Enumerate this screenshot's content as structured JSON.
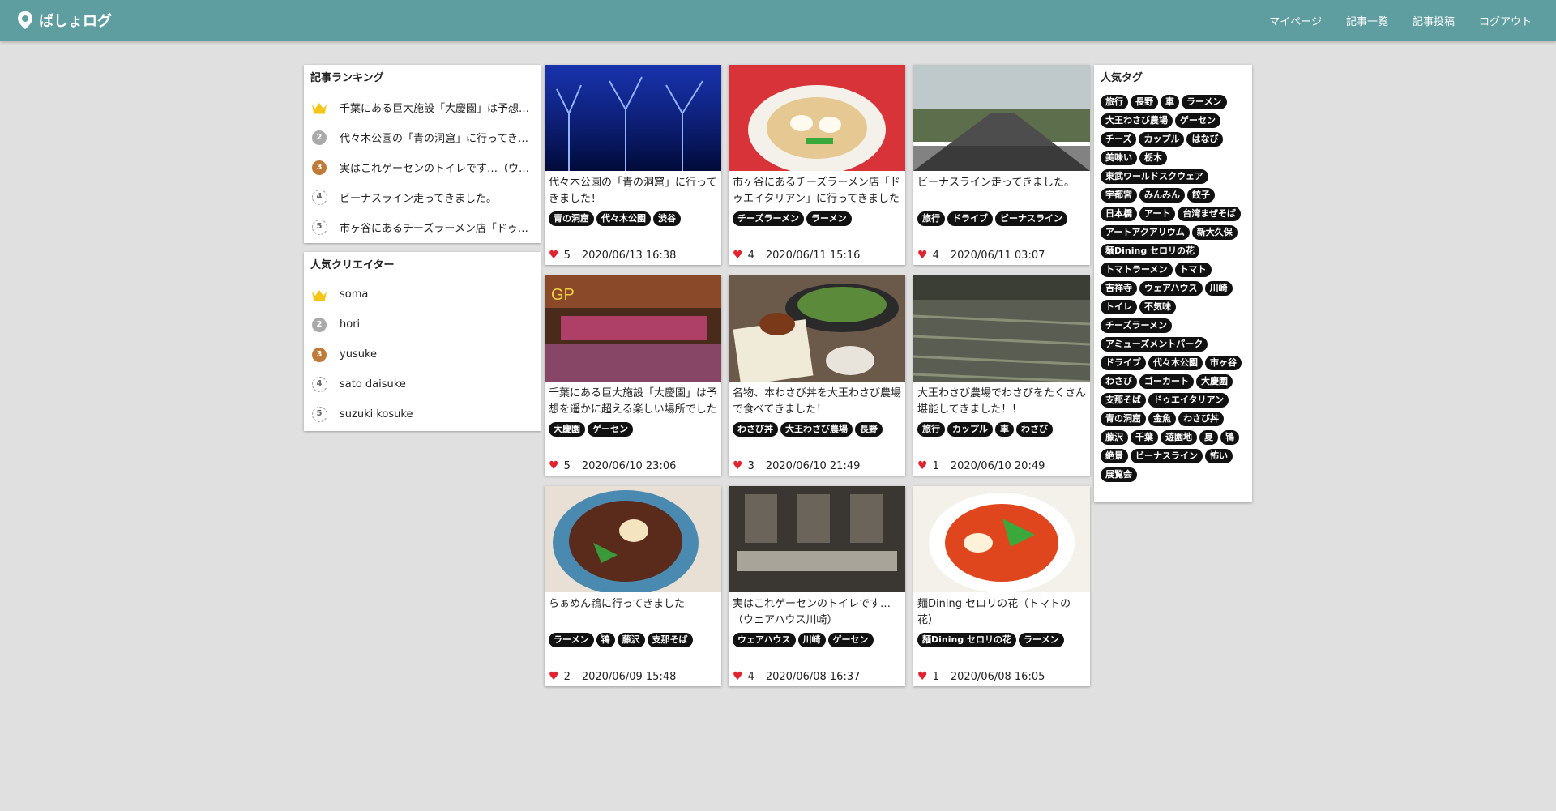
{
  "app": {
    "title": "ばしょログ"
  },
  "nav": {
    "mypage": "マイページ",
    "articles": "記事一覧",
    "post": "記事投稿",
    "logout": "ログアウト"
  },
  "ranking": {
    "title": "記事ランキング",
    "items": [
      {
        "rank": "1",
        "text": "千葉にある巨大施設「大慶園」は予想を遥かに超える楽しい場所でした"
      },
      {
        "rank": "2",
        "text": "代々木公園の「青の洞窟」に行ってきました！"
      },
      {
        "rank": "3",
        "text": "実はこれゲーセンのトイレです…（ウェアハウス川崎）"
      },
      {
        "rank": "4",
        "text": "ビーナスライン走ってきました。"
      },
      {
        "rank": "5",
        "text": "市ヶ谷にあるチーズラーメン店「ドゥエイタリアン」に行ってきました"
      }
    ]
  },
  "creators": {
    "title": "人気クリエイター",
    "items": [
      {
        "rank": "1",
        "name": "soma"
      },
      {
        "rank": "2",
        "name": "hori"
      },
      {
        "rank": "3",
        "name": "yusuke"
      },
      {
        "rank": "4",
        "name": "sato daisuke"
      },
      {
        "rank": "5",
        "name": "suzuki kosuke"
      }
    ]
  },
  "posts": [
    {
      "title": "代々木公園の「青の洞窟」に行ってきました！",
      "tags": [
        "青の洞窟",
        "代々木公園",
        "渋谷"
      ],
      "likes": "5",
      "date": "2020/06/13 16:38",
      "image": "blue-illumination"
    },
    {
      "title": "市ヶ谷にあるチーズラーメン店「ドゥエイタリアン」に行ってきました",
      "tags": [
        "チーズラーメン",
        "ラーメン"
      ],
      "likes": "4",
      "date": "2020/06/11 15:16",
      "image": "cheese-ramen"
    },
    {
      "title": "ビーナスライン走ってきました。",
      "tags": [
        "旅行",
        "ドライブ",
        "ビーナスライン"
      ],
      "likes": "4",
      "date": "2020/06/11 03:07",
      "image": "road"
    },
    {
      "title": "千葉にある巨大施設「大慶園」は予想を遥かに超える楽しい場所でした",
      "tags": [
        "大慶園",
        "ゲーセン"
      ],
      "likes": "5",
      "date": "2020/06/10 23:06",
      "image": "arcade"
    },
    {
      "title": "名物、本わさび丼を大王わさび農場で食べてきました！",
      "tags": [
        "わさび丼",
        "大王わさび農場",
        "長野"
      ],
      "likes": "3",
      "date": "2020/06/10 21:49",
      "image": "wasabi-bowl"
    },
    {
      "title": "大王わさび農場でわさびをたくさん堪能してきました！！",
      "tags": [
        "旅行",
        "カップル",
        "車",
        "わさび"
      ],
      "likes": "1",
      "date": "2020/06/10 20:49",
      "image": "wasabi-farm"
    },
    {
      "title": "らぁめん鴇に行ってきました",
      "tags": [
        "ラーメン",
        "鴇",
        "藤沢",
        "支那そば"
      ],
      "likes": "2",
      "date": "2020/06/09 15:48",
      "image": "ramen"
    },
    {
      "title": "実はこれゲーセンのトイレです…（ウェアハウス川崎）",
      "tags": [
        "ウェアハウス",
        "川崎",
        "ゲーセン"
      ],
      "likes": "4",
      "date": "2020/06/08 16:37",
      "image": "toilet"
    },
    {
      "title": "麺Dining セロリの花（トマトの花）",
      "tags": [
        "麺Dining セロリの花",
        "ラーメン"
      ],
      "likes": "1",
      "date": "2020/06/08 16:05",
      "image": "tomato-ramen"
    }
  ],
  "tags": {
    "title": "人気タグ",
    "items": [
      "旅行",
      "長野",
      "車",
      "ラーメン",
      "大王わさび農場",
      "ゲーセン",
      "チーズ",
      "カップル",
      "はなび",
      "美味い",
      "栃木",
      "東武ワールドスクウェア",
      "宇都宮",
      "みんみん",
      "餃子",
      "日本橋",
      "アート",
      "台湾まぜそば",
      "アートアクアリウム",
      "新大久保",
      "麺Dining セロリの花",
      "トマトラーメン",
      "トマト",
      "吉祥寺",
      "ウェアハウス",
      "川崎",
      "トイレ",
      "不気味",
      "チーズラーメン",
      "アミューズメントパーク",
      "ドライブ",
      "代々木公園",
      "市ヶ谷",
      "わさび",
      "ゴーカート",
      "大慶園",
      "支那そば",
      "ドゥエイタリアン",
      "青の洞窟",
      "金魚",
      "わさび丼",
      "藤沢",
      "千葉",
      "遊園地",
      "夏",
      "鴇",
      "絶景",
      "ビーナスライン",
      "怖い",
      "展覧会"
    ]
  },
  "colors": {
    "header": "#5f9ea0",
    "heart": "#e0232e",
    "gold": "#f5c518",
    "silver": "#aaaaaa",
    "bronze": "#c07a3a"
  }
}
